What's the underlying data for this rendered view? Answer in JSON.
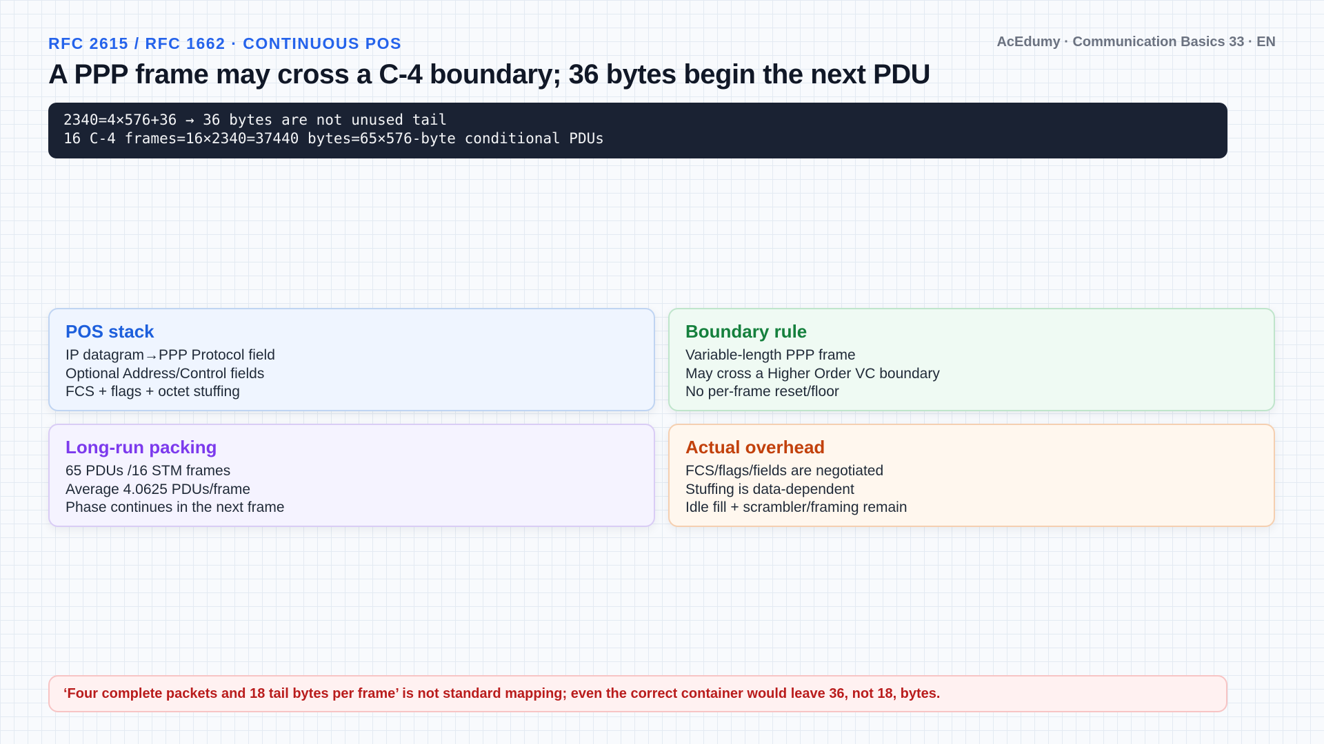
{
  "header": {
    "eyebrow": "RFC 2615 / RFC 1662 · CONTINUOUS POS",
    "brand": "AcEdumy · Communication Basics 33 · EN",
    "title": "A PPP frame may cross a C-4 boundary; 36 bytes begin the next PDU"
  },
  "code": {
    "lines": [
      "2340=4×576+36 → 36 bytes are not unused tail",
      "16 C-4 frames=16×2340=37440 bytes=65×576-byte conditional PDUs"
    ]
  },
  "cards": [
    {
      "heading": "POS stack",
      "color": "#1d5fdc",
      "lines": [
        "IP datagram→PPP Protocol field",
        "Optional Address/Control fields",
        "FCS + flags + octet stuffing"
      ]
    },
    {
      "heading": "Boundary rule",
      "color": "#15803d",
      "lines": [
        "Variable-length PPP frame",
        "May cross a Higher Order VC boundary",
        "No per-frame reset/floor"
      ]
    },
    {
      "heading": "Long-run packing",
      "color": "#7c3aed",
      "lines": [
        "65 PDUs /16 STM frames",
        "Average 4.0625 PDUs/frame",
        "Phase continues in the next frame"
      ]
    },
    {
      "heading": "Actual overhead",
      "color": "#c2410c",
      "lines": [
        "FCS/flags/fields are negotiated",
        "Stuffing is data-dependent",
        "Idle fill + scrambler/framing remain"
      ]
    }
  ],
  "warning": {
    "text": "‘Four complete packets and 18 tail bytes per frame’ is not standard mapping; even the correct container would leave 36, not 18, bytes."
  }
}
